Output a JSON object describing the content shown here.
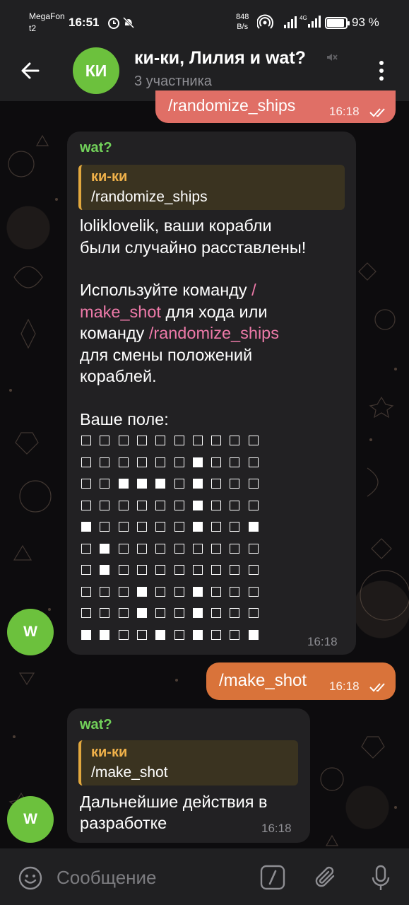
{
  "status_bar": {
    "carrier1": "MegaFon",
    "carrier2": "t2",
    "time": "16:51",
    "net_speed_value": "848",
    "net_speed_unit": "B/s",
    "battery_percent": "93 %",
    "battery_level": 0.93
  },
  "header": {
    "avatar_initials": "КИ",
    "title": "ки-ки, Лилия и wat?",
    "subtitle": "3 участника"
  },
  "messages": [
    {
      "direction": "out",
      "text": "/randomize_ships",
      "time": "16:18",
      "read": true
    },
    {
      "direction": "in",
      "sender": "wat?",
      "avatar": "W",
      "reply": {
        "name": "ки-ки",
        "text": "/randomize_ships"
      },
      "text_line1": "loliklovelik, ваши корабли",
      "text_line2": "были случайно расставлены!",
      "text_p2_line1_a": "Используйте команду ",
      "text_p2_line1_cmd": "/",
      "text_p2_line2_cmd": "make_shot",
      "text_p2_line2_b": " для хода или",
      "text_p2_line3_a": "команду ",
      "text_p2_line3_cmd": "/randomize_ships",
      "text_p2_line4": "для смены положений",
      "text_p2_line5": "кораблей.",
      "board_label": "Ваше поле:",
      "board": [
        "□□□□□□□□□□",
        "□□□□□□■□□□",
        "□□■■■□■□□□",
        "□□□□□□■□□□",
        "■□□□□□■□□■",
        "□■□□□□□□□□",
        "□■□□□□□□□□",
        "□□□■□□■□□□",
        "□□□■□□■□□□",
        "■■□□■□■□□■"
      ],
      "time": "16:18"
    },
    {
      "direction": "out",
      "text": "/make_shot",
      "time": "16:18",
      "read": true
    },
    {
      "direction": "in",
      "sender": "wat?",
      "avatar": "W",
      "reply": {
        "name": "ки-ки",
        "text": "/make_shot"
      },
      "text_line1": "Дальнейшие действия в",
      "text_line2": "разработке",
      "time": "16:18"
    }
  ],
  "input": {
    "placeholder": "Сообщение"
  },
  "icons": {
    "back": "arrow-left-icon",
    "menu": "more-vertical-icon",
    "mute": "muted-icon",
    "emoji": "emoji-icon",
    "commands": "slash-commands-icon",
    "attach": "paperclip-icon",
    "mic": "microphone-icon"
  },
  "colors": {
    "bar_bg": "#202022",
    "avatar_green": "#6cc13d",
    "sender_green": "#72d15a",
    "outgoing_pink": "#e06f66",
    "outgoing_orange": "#d9733a",
    "incoming_bg": "#222123",
    "command_pink": "#ee7aa9",
    "reply_accent": "#f1b24a"
  }
}
